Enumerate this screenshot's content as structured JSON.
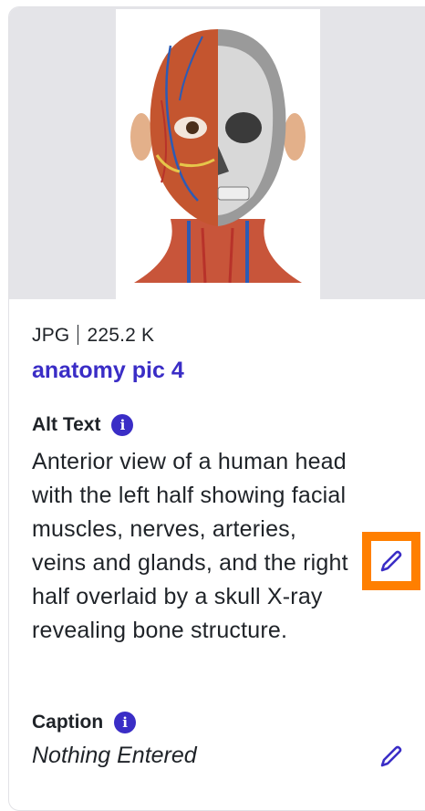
{
  "image": {
    "format": "JPG",
    "size": "225.2 K",
    "name": "anatomy pic 4"
  },
  "alt_text": {
    "label": "Alt Text",
    "value": "Anterior view of a human head with the left half showing facial muscles, nerves, arteries, veins and glands, and the right half overlaid by a skull X-ray revealing bone structure."
  },
  "caption": {
    "label": "Caption",
    "value": "Nothing Entered"
  },
  "icons": {
    "info": "info-icon",
    "edit": "pencil-icon"
  },
  "colors": {
    "accent": "#3a2dc6",
    "focus": "#ff7f00",
    "thumb_bg": "#e4e4e8"
  }
}
